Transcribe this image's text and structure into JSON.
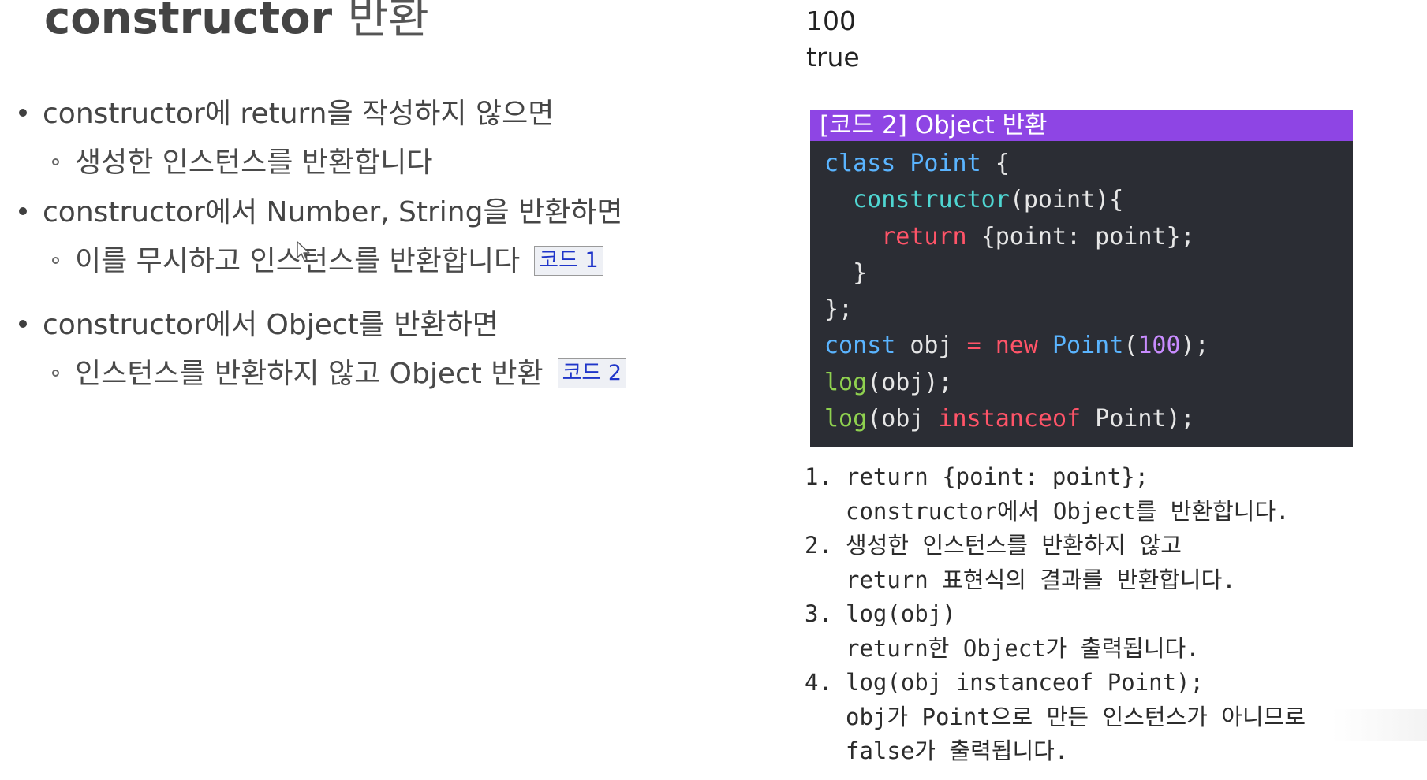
{
  "title": {
    "keyword": "constructor",
    "korean": "반환"
  },
  "bullets": [
    {
      "text": "constructor에 return을 작성하지 않으면",
      "sub": {
        "text": "생성한 인스턴스를 반환합니다",
        "link": ""
      }
    },
    {
      "text": "constructor에서 Number, String을 반환하면",
      "sub": {
        "text": "이를 무시하고 인스턴스를 반환합니다",
        "link": "코드 1"
      }
    },
    {
      "text": "constructor에서 Object를 반환하면",
      "sub": {
        "text": "인스턴스를 반환하지 않고 Object 반환",
        "link": "코드 2"
      }
    }
  ],
  "output": {
    "lines": [
      "100",
      "true"
    ]
  },
  "code_block": {
    "header": "[코드 2] Object 반환",
    "lines": [
      [
        {
          "t": "class ",
          "c": "kw"
        },
        {
          "t": "Point ",
          "c": "cls"
        },
        {
          "t": "{",
          "c": "txt"
        }
      ],
      [
        {
          "t": "  ",
          "c": "txt"
        },
        {
          "t": "constructor",
          "c": "fn"
        },
        {
          "t": "(point){",
          "c": "txt"
        }
      ],
      [
        {
          "t": "    ",
          "c": "txt"
        },
        {
          "t": "return ",
          "c": "ret"
        },
        {
          "t": "{point: point};",
          "c": "txt"
        }
      ],
      [
        {
          "t": "  }",
          "c": "txt"
        }
      ],
      [
        {
          "t": "};",
          "c": "txt"
        }
      ],
      [
        {
          "t": "const ",
          "c": "kw"
        },
        {
          "t": "obj ",
          "c": "txt"
        },
        {
          "t": "= ",
          "c": "op"
        },
        {
          "t": "new ",
          "c": "ret"
        },
        {
          "t": "Point",
          "c": "cls"
        },
        {
          "t": "(",
          "c": "txt"
        },
        {
          "t": "100",
          "c": "num"
        },
        {
          "t": ");",
          "c": "txt"
        }
      ],
      [
        {
          "t": "log",
          "c": "log"
        },
        {
          "t": "(obj);",
          "c": "txt"
        }
      ],
      [
        {
          "t": "log",
          "c": "log"
        },
        {
          "t": "(obj ",
          "c": "txt"
        },
        {
          "t": "instanceof ",
          "c": "ret"
        },
        {
          "t": "Point);",
          "c": "txt"
        }
      ]
    ]
  },
  "notes": [
    {
      "num": "1.",
      "lines": [
        "return {point: point};",
        "constructor에서 Object를 반환합니다."
      ]
    },
    {
      "num": "2.",
      "lines": [
        "생성한 인스턴스를 반환하지 않고",
        "return 표현식의 결과를 반환합니다."
      ]
    },
    {
      "num": "3.",
      "lines": [
        "log(obj)",
        "return한 Object가 출력됩니다."
      ]
    },
    {
      "num": "4.",
      "lines": [
        "log(obj instanceof Point);",
        "obj가 Point으로 만든 인스턴스가 아니므로",
        "false가 출력됩니다."
      ]
    }
  ]
}
